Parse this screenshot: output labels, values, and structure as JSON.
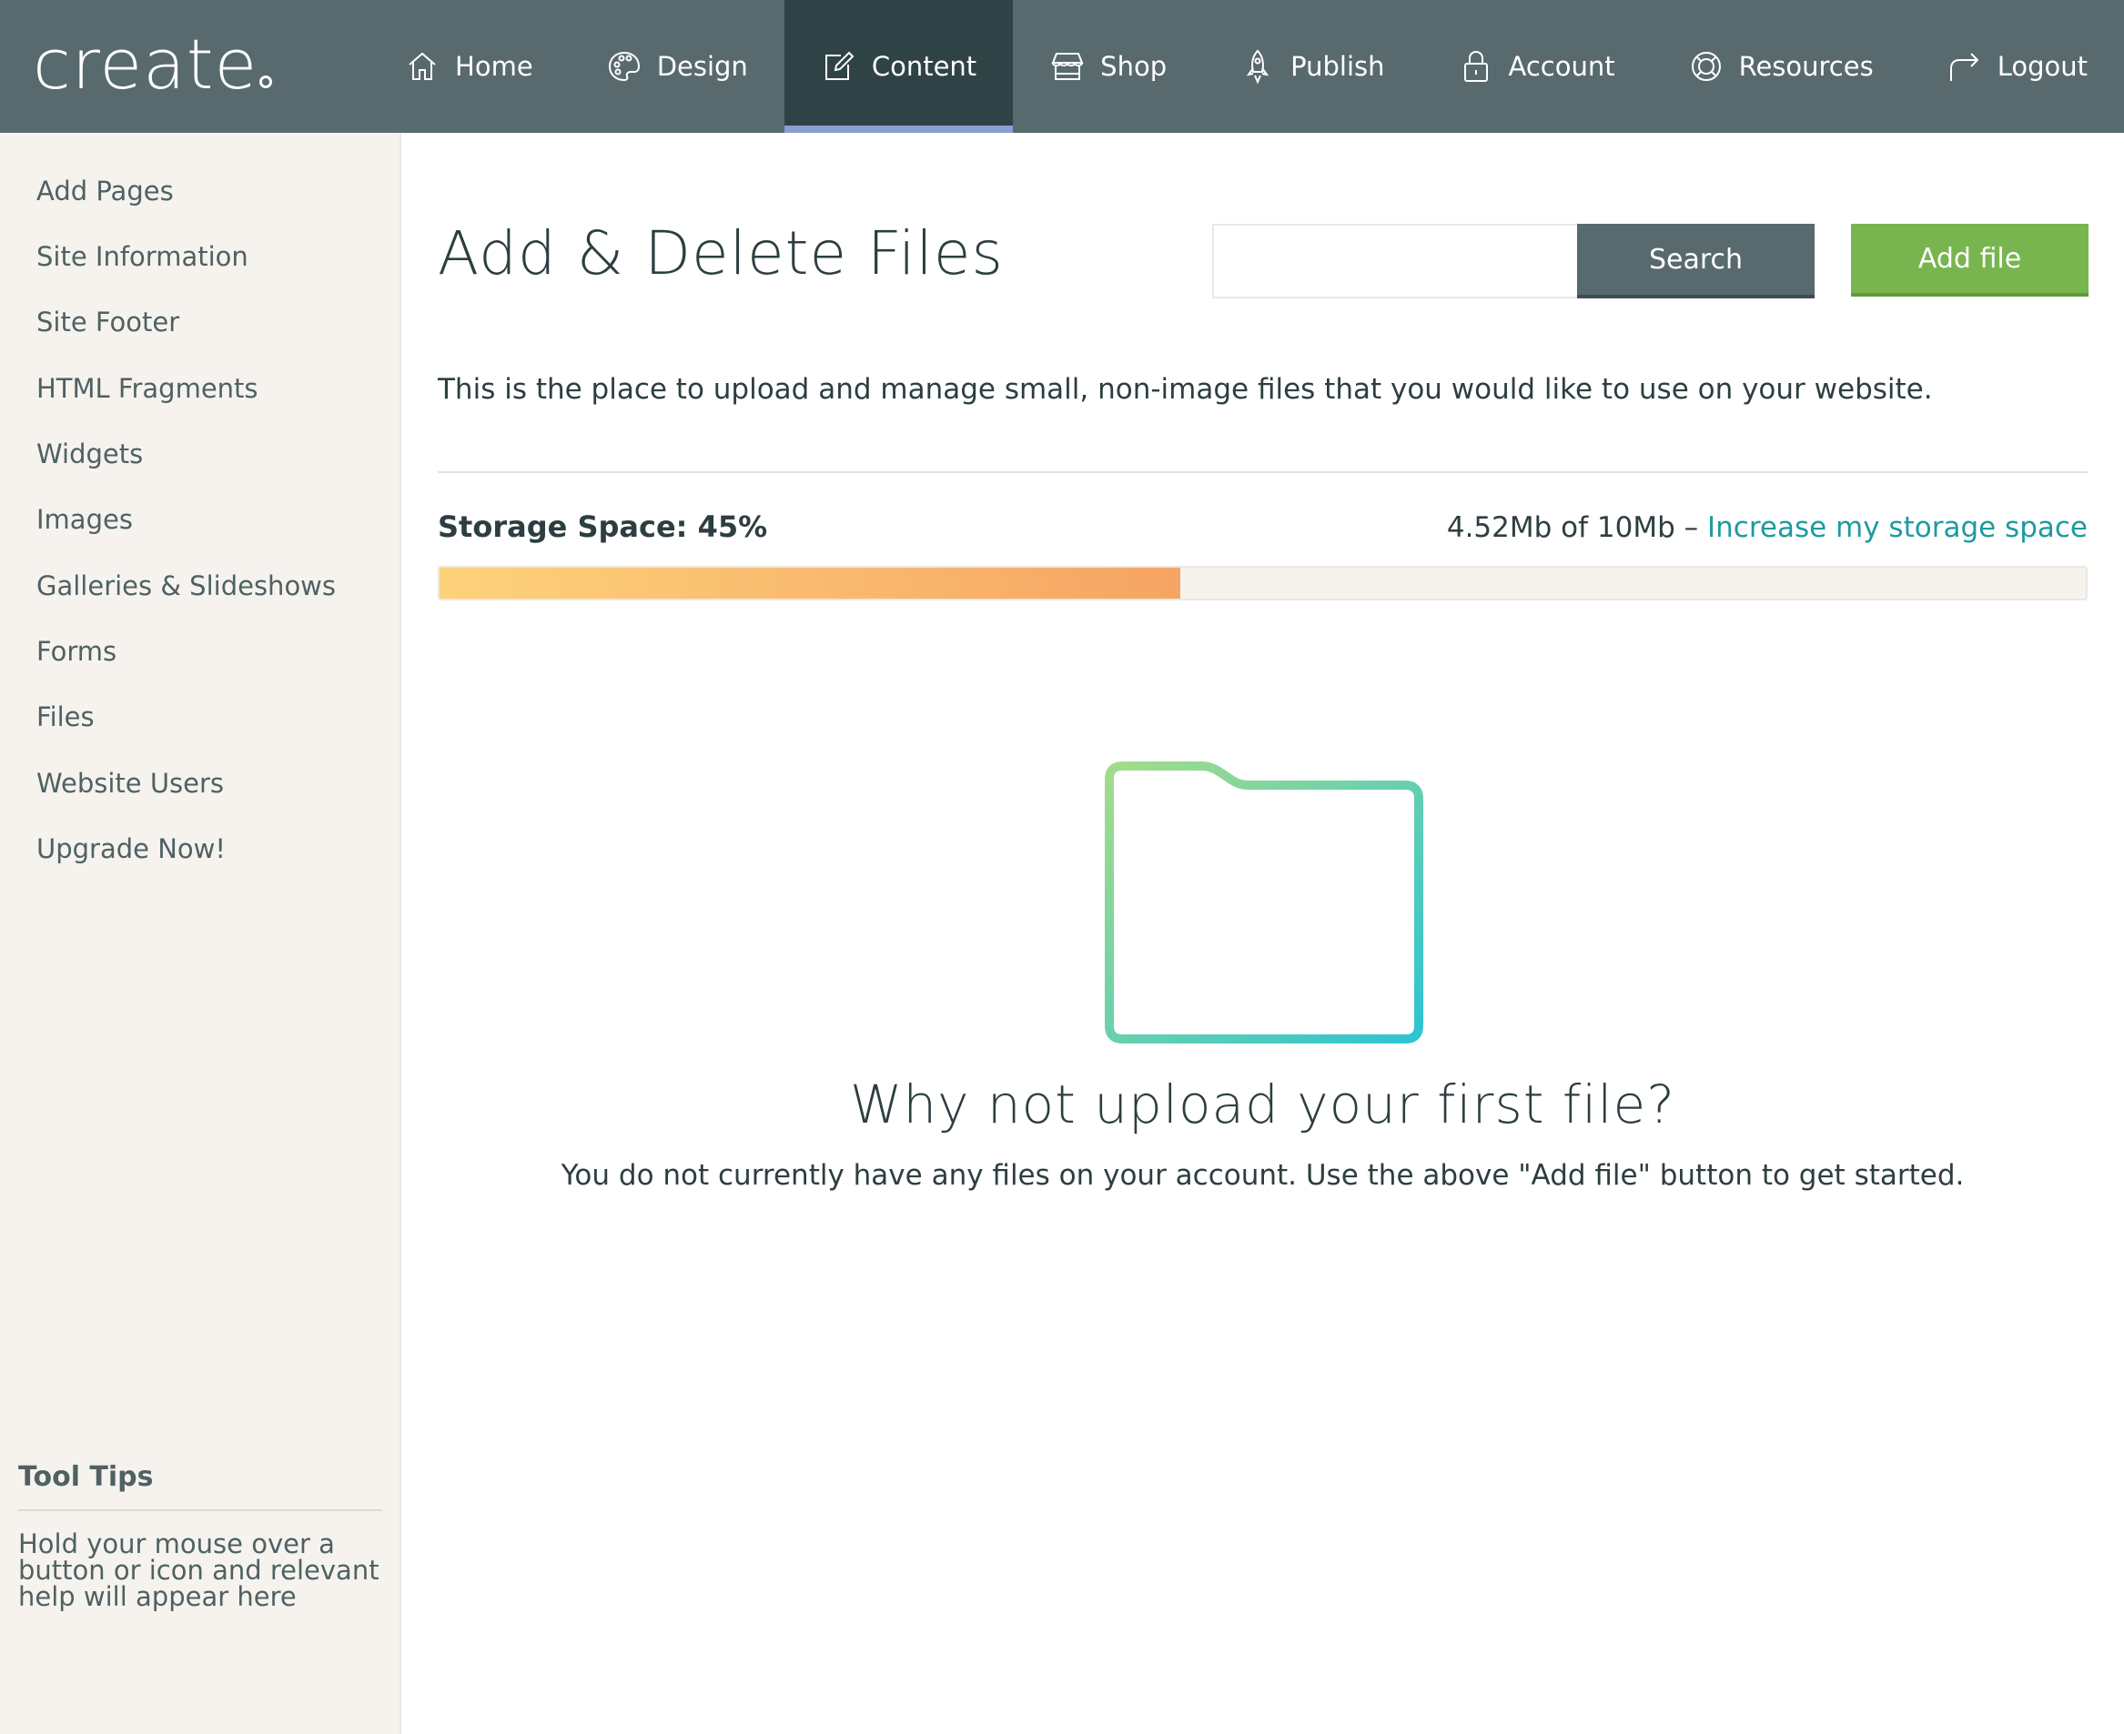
{
  "app": {
    "logo_text": "create"
  },
  "nav": {
    "items": [
      {
        "label": "Home",
        "icon": "home-icon"
      },
      {
        "label": "Design",
        "icon": "palette-icon"
      },
      {
        "label": "Content",
        "icon": "edit-icon",
        "active": true
      },
      {
        "label": "Shop",
        "icon": "shop-icon"
      },
      {
        "label": "Publish",
        "icon": "rocket-icon"
      },
      {
        "label": "Account",
        "icon": "lock-icon"
      },
      {
        "label": "Resources",
        "icon": "lifebuoy-icon"
      },
      {
        "label": "Logout",
        "icon": "logout-arrow-icon"
      }
    ]
  },
  "sidebar": {
    "items": [
      {
        "label": "Add Pages"
      },
      {
        "label": "Site Information"
      },
      {
        "label": "Site Footer"
      },
      {
        "label": "HTML Fragments"
      },
      {
        "label": "Widgets"
      },
      {
        "label": "Images"
      },
      {
        "label": "Galleries & Slideshows"
      },
      {
        "label": "Forms"
      },
      {
        "label": "Files"
      },
      {
        "label": "Website Users"
      },
      {
        "label": "Upgrade Now!"
      }
    ],
    "tooltips": {
      "title": "Tool Tips",
      "text": "Hold your mouse over a button or icon and relevant help will appear here"
    }
  },
  "main": {
    "title": "Add & Delete Files",
    "search": {
      "value": "",
      "placeholder": "",
      "button_label": "Search"
    },
    "add_button_label": "Add file",
    "intro": "This is the place to upload and manage small, non-image files that you would like to use on your website.",
    "storage": {
      "label": "Storage Space: 45%",
      "percent": 45,
      "usage_text": "4.52Mb of 10Mb – ",
      "link_text": "Increase my storage space"
    },
    "empty_state": {
      "icon": "folder-icon",
      "title": "Why not upload your first file?",
      "text": "You do not currently have any files on your account. Use the above \"Add file\" button to get started."
    }
  },
  "colors": {
    "topbar": "#586a6e",
    "active_nav": "#2f4346",
    "add_button": "#78b54f",
    "link": "#1f9aa0",
    "progress_start": "#fdd27b",
    "progress_end": "#f6a464"
  }
}
